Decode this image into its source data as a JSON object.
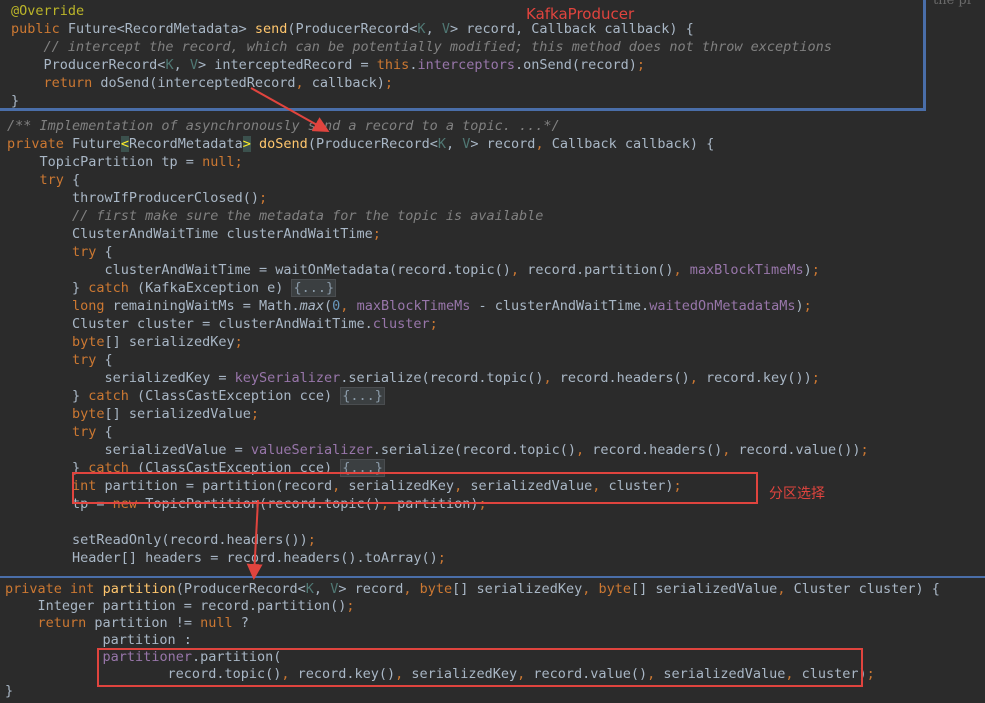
{
  "colors": {
    "background": "#2b2b2b",
    "keyword": "#cc7832",
    "comment": "#808080",
    "annotation": "#bbb529",
    "method_declaration": "#ffc66d",
    "field": "#9876aa",
    "type_parameter": "#507874",
    "number": "#6897bb",
    "plain": "#a9b7c6",
    "highlight_box": "#e0443e",
    "popup_border": "#4a6ea9"
  },
  "annotations": {
    "kafka_producer_label": "KafkaProducer",
    "partition_selection_label": "分区选择",
    "right_edge_fragment": "the pr"
  },
  "top_snippet": [
    [
      "@Override",
      "an"
    ],
    [
      "public",
      "kw",
      " Future<RecordMetadata> ",
      "",
      "send",
      "fn",
      "(ProducerRecord<",
      "",
      "K",
      "tp",
      ", ",
      "",
      "V",
      "tp",
      "> record, Callback callback) {",
      ""
    ],
    [
      "    // intercept the record, which can be potentially modified; this method does not throw exceptions",
      "cm"
    ],
    [
      "    ProducerRecord<",
      "",
      "K",
      "tp",
      ", ",
      "",
      "V",
      "tp",
      "> interceptedRecord = ",
      "",
      "this",
      "kw",
      ".",
      "",
      "interceptors",
      "fld",
      ".onSend(record)",
      "",
      ";",
      "kw"
    ],
    [
      "    ",
      "",
      "return",
      "kw",
      " doSend(interceptedRecord",
      "",
      ",",
      "kw",
      " callback)",
      "",
      ";",
      "kw"
    ],
    [
      "}",
      ""
    ]
  ],
  "main_editor": [
    [
      "/** Implementation of asynchronously send a record to a topic. ...*/",
      "cm"
    ],
    [
      "private",
      "kw",
      " Future",
      "",
      "<",
      "bh",
      "RecordMetadata",
      "",
      ">",
      "bh",
      " ",
      "",
      "doSend",
      "fn",
      "(ProducerRecord<",
      "",
      "K",
      "tp",
      ", ",
      "",
      "V",
      "tp",
      "> record",
      "",
      ",",
      "kw",
      " Callback callback) {",
      ""
    ],
    [
      "    TopicPartition tp = ",
      "",
      "null",
      "kw",
      ";",
      "kw"
    ],
    [
      "    ",
      "",
      "try",
      "kw",
      " {",
      ""
    ],
    [
      "        throwIfProducerClosed()",
      "",
      ";",
      "kw"
    ],
    [
      "        // first make sure the metadata for the topic is available",
      "cm"
    ],
    [
      "        ClusterAndWaitTime clusterAndWaitTime",
      "",
      ";",
      "kw"
    ],
    [
      "        ",
      "",
      "try",
      "kw",
      " {",
      ""
    ],
    [
      "            clusterAndWaitTime = waitOnMetadata(record.topic()",
      "",
      ",",
      "kw",
      " record.partition()",
      "",
      ",",
      "kw",
      " ",
      "",
      "maxBlockTimeMs",
      "fld",
      ")",
      "",
      ";",
      "kw"
    ],
    [
      "        } ",
      "",
      "catch",
      "kw",
      " (KafkaException e) ",
      "",
      "{...}",
      "fold"
    ],
    [
      "        ",
      "",
      "long",
      "kw",
      " remainingWaitMs = Math.",
      "",
      "max",
      "it",
      "(",
      "",
      "0",
      "num",
      ",",
      "kw",
      " ",
      "",
      "maxBlockTimeMs",
      "fld",
      " - clusterAndWaitTime.",
      "",
      "waitedOnMetadataMs",
      "fld",
      ")",
      "",
      ";",
      "kw"
    ],
    [
      "        Cluster cluster = clusterAndWaitTime.",
      "",
      "cluster",
      "fld",
      ";",
      "kw"
    ],
    [
      "        ",
      "",
      "byte",
      "kw",
      "[] serializedKey",
      "",
      ";",
      "kw"
    ],
    [
      "        ",
      "",
      "try",
      "kw",
      " {",
      ""
    ],
    [
      "            serializedKey = ",
      "",
      "keySerializer",
      "fld",
      ".serialize(record.topic()",
      "",
      ",",
      "kw",
      " record.headers()",
      "",
      ",",
      "kw",
      " record.key())",
      "",
      ";",
      "kw"
    ],
    [
      "        } ",
      "",
      "catch",
      "kw",
      " (ClassCastException cce) ",
      "",
      "{...}",
      "fold"
    ],
    [
      "        ",
      "",
      "byte",
      "kw",
      "[] serializedValue",
      "",
      ";",
      "kw"
    ],
    [
      "        ",
      "",
      "try",
      "kw",
      " {",
      ""
    ],
    [
      "            serializedValue = ",
      "",
      "valueSerializer",
      "fld",
      ".serialize(record.topic()",
      "",
      ",",
      "kw",
      " record.headers()",
      "",
      ",",
      "kw",
      " record.value())",
      "",
      ";",
      "kw"
    ],
    [
      "        } ",
      "",
      "catch",
      "kw",
      " (ClassCastException cce) ",
      "",
      "{...}",
      "fold"
    ],
    [
      "        ",
      "",
      "int",
      "kw",
      " partition = partition(record",
      "",
      ",",
      "kw",
      " serializedKey",
      "",
      ",",
      "kw",
      " serializedValue",
      "",
      ",",
      "kw",
      " cluster)",
      "",
      ";",
      "kw"
    ],
    [
      "        tp = ",
      "",
      "new",
      "kw",
      " TopicPartition(record.topic()",
      "",
      ",",
      "kw",
      " partition)",
      "",
      ";",
      "kw"
    ],
    [
      "",
      ""
    ],
    [
      "        setReadOnly(record.headers())",
      "",
      ";",
      "kw"
    ],
    [
      "        Header[] headers = record.headers().toArray()",
      "",
      ";",
      "kw"
    ]
  ],
  "bottom_snippet": [
    [
      "private",
      "kw",
      " ",
      "",
      "int",
      "kw",
      " ",
      "",
      "partition",
      "fn",
      "(ProducerRecord<",
      "",
      "K",
      "tp",
      ", ",
      "",
      "V",
      "tp",
      "> record",
      "",
      ",",
      "kw",
      " ",
      "",
      "byte",
      "kw",
      "[] serializedKey",
      "",
      ",",
      "kw",
      " ",
      "",
      "byte",
      "kw",
      "[] serializedValue",
      "",
      ",",
      "kw",
      " Cluster cluster) {",
      ""
    ],
    [
      "    Integer partition = record.partition()",
      "",
      ";",
      "kw"
    ],
    [
      "    ",
      "",
      "return",
      "kw",
      " partition != ",
      "",
      "null",
      "kw",
      " ?",
      ""
    ],
    [
      "            partition :",
      ""
    ],
    [
      "            ",
      "",
      "partitioner",
      "fld",
      ".partition(",
      ""
    ],
    [
      "                    record.topic()",
      "",
      ",",
      "kw",
      " record.key()",
      "",
      ",",
      "kw",
      " serializedKey",
      "",
      ",",
      "kw",
      " record.value()",
      "",
      ",",
      "kw",
      " serializedValue",
      "",
      ",",
      "kw",
      " cluster)",
      "",
      ";",
      "kw"
    ],
    [
      "}",
      ""
    ]
  ]
}
